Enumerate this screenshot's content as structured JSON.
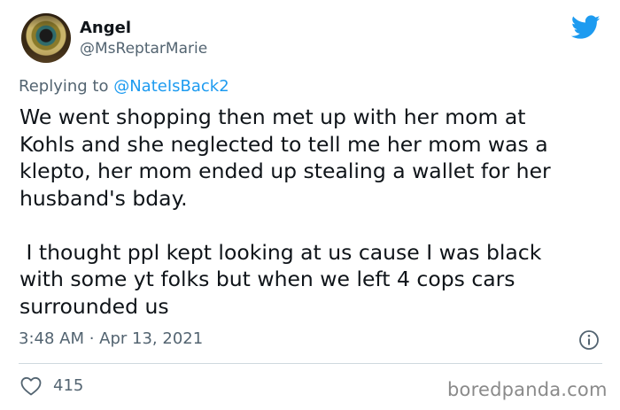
{
  "author": {
    "name": "Angel",
    "handle": "@MsReptarMarie"
  },
  "reply": {
    "prefix": "Replying to ",
    "mention": "@NateIsBack2"
  },
  "tweet": {
    "text": "We went shopping then met up with her mom at\nKohls and she neglected to tell me her mom was a\nklepto, her mom ended up stealing a wallet for her\nhusband's bday.\n\n I thought ppl kept looking at us cause I was black\nwith some yt folks but when we left 4 cops cars\nsurrounded us",
    "timestamp": "3:48 AM · Apr 13, 2021",
    "like_count": "415"
  },
  "watermark": "boredpanda.com",
  "icons": {
    "brand": "twitter-bird-icon",
    "info": "info-icon",
    "like": "heart-icon"
  },
  "colors": {
    "twitter_blue": "#1d9bf0",
    "secondary_text": "#536471",
    "primary_text": "#0f1419",
    "divider": "#cfd9de"
  }
}
